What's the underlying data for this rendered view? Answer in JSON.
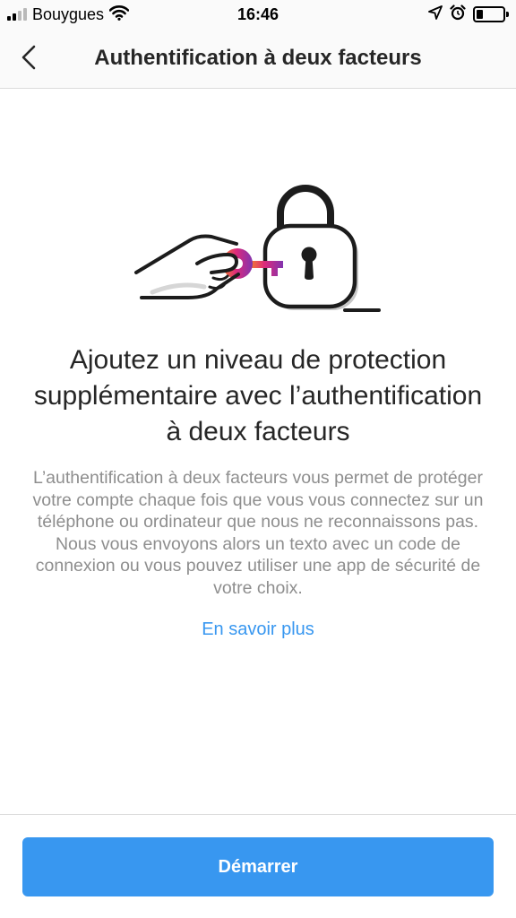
{
  "status_bar": {
    "carrier": "Bouygues",
    "time": "16:46",
    "battery_level_fraction": 0.25,
    "icons": [
      "signal-icon",
      "wifi-icon",
      "location-arrow-icon",
      "alarm-icon",
      "battery-icon"
    ]
  },
  "nav": {
    "title": "Authentification à deux facteurs",
    "back_icon": "chevron-left-icon"
  },
  "illustration": {
    "icon": "hand-key-padlock-illustration"
  },
  "content": {
    "heading": "Ajoutez un niveau de protection supplémentaire avec l’authentification à deux facteurs",
    "description": "L’authentification à deux facteurs vous permet de protéger votre compte chaque fois que vous vous connectez sur un téléphone ou ordinateur que nous ne reconnaissons pas. Nous vous envoyons alors un texto avec un code de connexion ou vous pouvez utiliser une app de sécurité de votre choix.",
    "learn_more": "En savoir plus"
  },
  "footer": {
    "start_label": "Démarrer"
  },
  "colors": {
    "accent": "#3897f0",
    "text_primary": "#262626",
    "text_secondary": "#8e8e8e",
    "divider": "#dbdbdb",
    "bar_background": "#fafafa"
  }
}
